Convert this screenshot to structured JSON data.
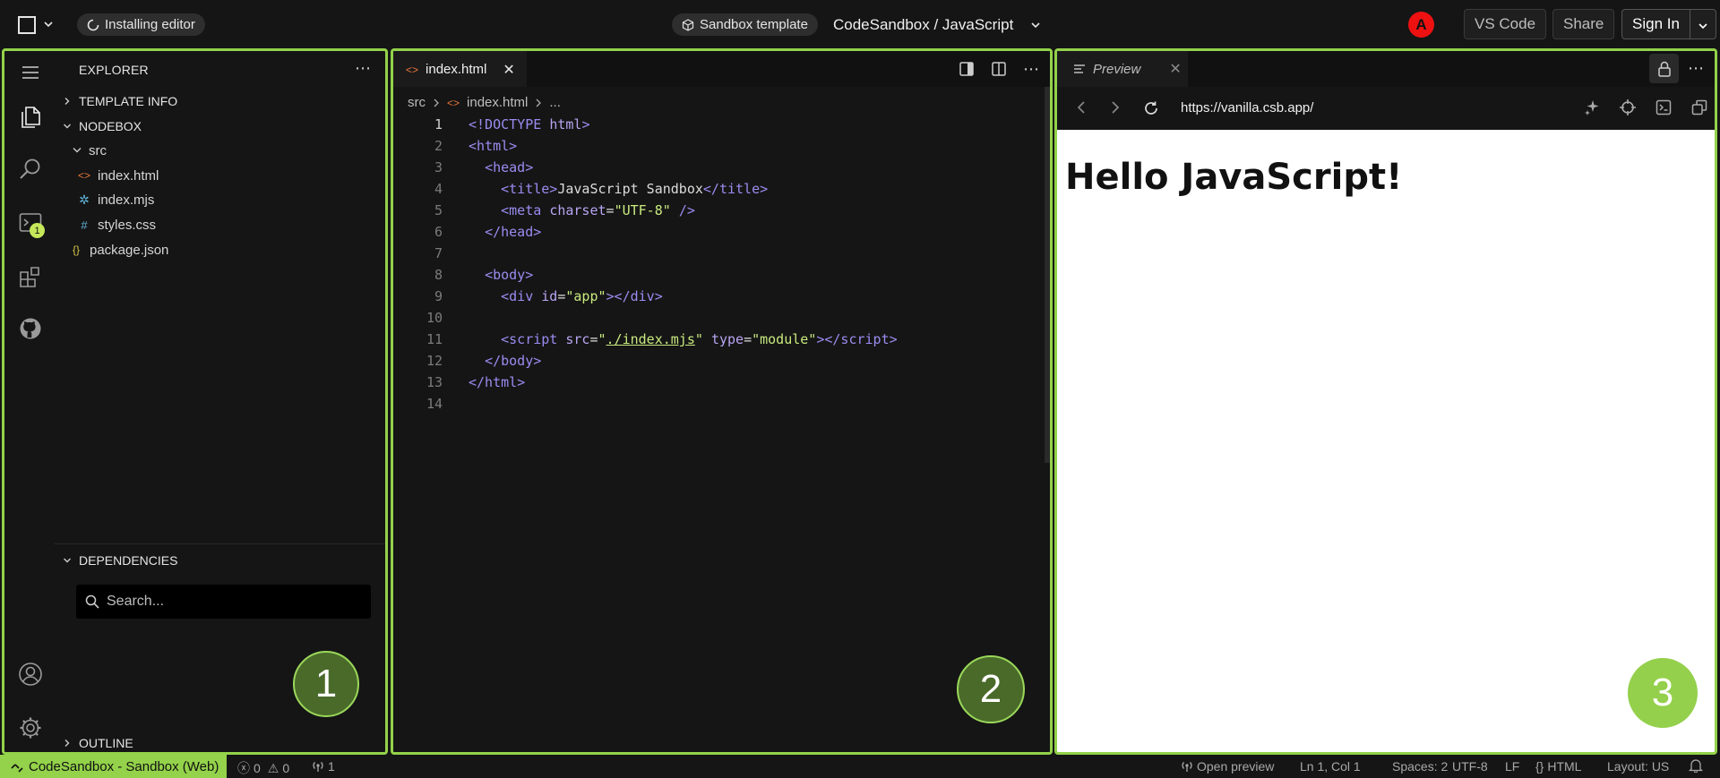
{
  "topbar": {
    "install_status": "Installing editor",
    "template_label": "Sandbox template",
    "title": "CodeSandbox / JavaScript",
    "avatar_initial": "A",
    "vscode_label": "VS Code",
    "share_label": "Share",
    "signin_label": "Sign In"
  },
  "explorer": {
    "heading": "EXPLORER",
    "sections": {
      "template_info": "TEMPLATE INFO",
      "nodebox": "NODEBOX",
      "dependencies": "DEPENDENCIES",
      "outline": "OUTLINE"
    },
    "tree": [
      {
        "name": "src",
        "kind": "folder"
      },
      {
        "name": "index.html",
        "kind": "html"
      },
      {
        "name": "index.mjs",
        "kind": "js"
      },
      {
        "name": "styles.css",
        "kind": "css"
      },
      {
        "name": "package.json",
        "kind": "json"
      }
    ],
    "terminal_badge": "1",
    "search_placeholder": "Search..."
  },
  "editor": {
    "tab_label": "index.html",
    "breadcrumb": [
      "src",
      "index.html",
      "..."
    ],
    "line_numbers": [
      "1",
      "2",
      "3",
      "4",
      "5",
      "6",
      "7",
      "8",
      "9",
      "10",
      "11",
      "12",
      "13",
      "14"
    ]
  },
  "preview": {
    "tab_label": "Preview",
    "url": "https://vanilla.csb.app/",
    "heading": "Hello JavaScript!"
  },
  "markers": [
    "1",
    "2",
    "3"
  ],
  "statusbar": {
    "remote": "CodeSandbox - Sandbox (Web)",
    "errors": "0",
    "warnings": "0",
    "ports": "1",
    "open_preview": "Open preview",
    "cursor": "Ln 1, Col 1",
    "spaces": "Spaces: 2",
    "encoding": "UTF-8",
    "eol": "LF",
    "language": "HTML",
    "layout": "Layout: US"
  },
  "colors": {
    "accent": "#93d24a",
    "marker_dark": "#4a6a2a",
    "marker_light": "#94d04c",
    "avatar": "#e11111"
  }
}
